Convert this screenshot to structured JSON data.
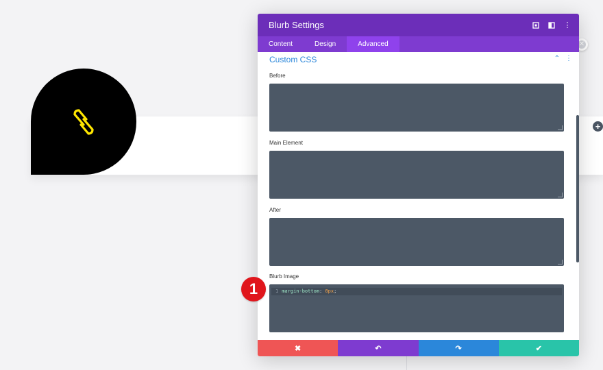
{
  "modal": {
    "title": "Blurb Settings",
    "header_icons": [
      "expand-icon",
      "sidebar-toggle-icon",
      "more-options-icon"
    ],
    "tabs": [
      {
        "label": "Content",
        "active": false
      },
      {
        "label": "Design",
        "active": false
      },
      {
        "label": "Advanced",
        "active": true
      }
    ],
    "section": {
      "title": "Custom CSS",
      "collapse_icon": "chevron-up-icon",
      "menu_icon": "more-options-icon"
    },
    "fields": [
      {
        "label": "Before",
        "value": ""
      },
      {
        "label": "Main Element",
        "value": ""
      },
      {
        "label": "After",
        "value": ""
      },
      {
        "label": "Blurb Image",
        "line_number": "1",
        "code_property": "margin-bottom",
        "code_colon": ":",
        "code_value": "0px",
        "code_semicolon": ";"
      }
    ],
    "footer": [
      {
        "name": "discard",
        "glyph": "✖",
        "color": "#ef5555"
      },
      {
        "name": "undo",
        "glyph": "↶",
        "color": "#7e3bd0"
      },
      {
        "name": "redo",
        "glyph": "↷",
        "color": "#2b87da"
      },
      {
        "name": "save",
        "glyph": "✔",
        "color": "#29c4a9"
      }
    ]
  },
  "callout": {
    "number": "1"
  },
  "colors": {
    "header": "#6c2eb9",
    "tabs": "#7e3bd0",
    "active_tab": "#8f42ec",
    "section_title": "#2b87da",
    "code_bg": "#4c5866",
    "blurb_icon": "#ffe600",
    "callout": "#e0161c"
  }
}
